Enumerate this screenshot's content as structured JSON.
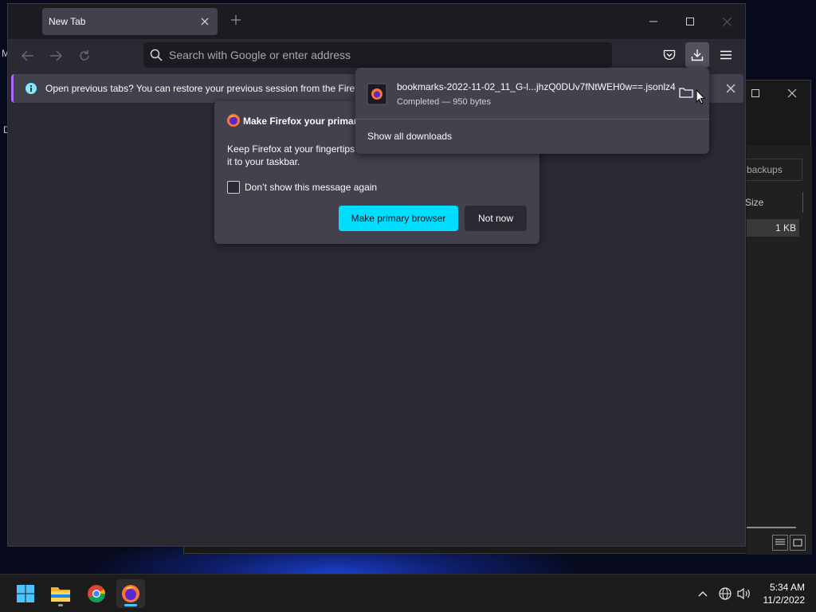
{
  "desktop": {
    "label_a": "M",
    "label_b": "D"
  },
  "explorer": {
    "search_text": "backups",
    "column_size": "Size",
    "row_size": "1 KB"
  },
  "firefox": {
    "tab_title": "New Tab",
    "url_placeholder": "Search with Google or enter address",
    "infobar_text": "Open previous tabs? You can restore your previous session from the Firefox"
  },
  "prompt": {
    "title": "Make Firefox your primary",
    "body": "Keep Firefox at your fingertips — make it your default browser and pin it to your taskbar.",
    "body_line1": "Keep Firefox at your fingertips",
    "body_line2": "it to your taskbar.",
    "checkbox_label": "Don’t show this message again",
    "primary_button": "Make primary browser",
    "secondary_button": "Not now"
  },
  "downloads": {
    "file_name": "bookmarks-2022-11-02_11_G-l...jhzQ0DUv7fNtWEH0w==.jsonlz4",
    "status": "Completed — 950 bytes",
    "show_all": "Show all downloads"
  },
  "taskbar": {
    "time": "5:34 AM",
    "date": "11/2/2022",
    "apps": [
      "start-icon",
      "file-explorer-icon",
      "chrome-icon",
      "firefox-icon"
    ]
  },
  "colors": {
    "accent": "#00ddff",
    "infobar_accent": "#b066ff",
    "panel": "#42414d",
    "toolbar": "#2b2a33"
  }
}
